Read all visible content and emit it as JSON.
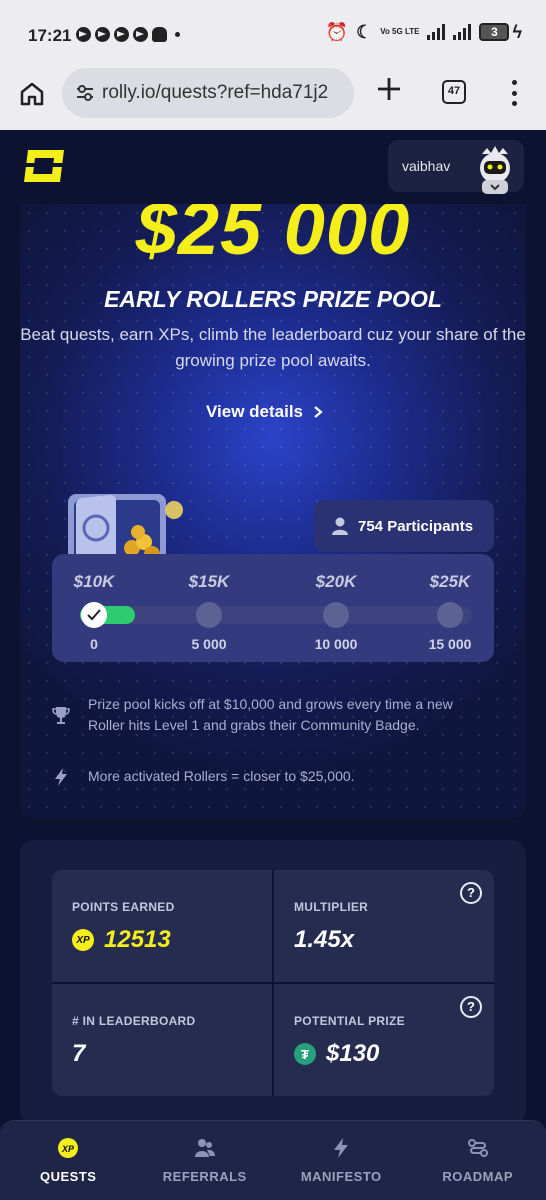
{
  "status_bar": {
    "time": "17:21",
    "network_label": "Vo 5G LTE",
    "battery": "3"
  },
  "browser": {
    "url": "rolly.io/quests?ref=hda71j2",
    "tab_count": "47"
  },
  "header": {
    "username": "vaibhav"
  },
  "hero": {
    "prize_amount": "$25 000",
    "title": "EARLY ROLLERS PRIZE POOL",
    "description": "Beat quests, earn XPs, climb the leaderboard cuz your share of the growing prize pool awaits.",
    "view_details": "View details",
    "participants": "754 Participants",
    "progress_fraction": 0.07,
    "tiers": [
      {
        "prize": "$10K",
        "xp": "0",
        "reached": true
      },
      {
        "prize": "$15K",
        "xp": "5 000",
        "reached": false
      },
      {
        "prize": "$20K",
        "xp": "10 000",
        "reached": false
      },
      {
        "prize": "$25K",
        "xp": "15 000",
        "reached": false
      }
    ],
    "note1": "Prize pool kicks off at $10,000 and grows every time a new Roller hits Level 1 and grabs their Community Badge.",
    "note2": "More activated Rollers = closer to $25,000."
  },
  "stats": {
    "points_label": "POINTS EARNED",
    "points_value": "12513",
    "multiplier_label": "MULTIPLIER",
    "multiplier_value": "1.45x",
    "leaderboard_label": "# IN LEADERBOARD",
    "leaderboard_value": "7",
    "prize_label": "POTENTIAL PRIZE",
    "prize_value": "$130",
    "xp_icon_text": "XP"
  },
  "nav": [
    {
      "label": "QUESTS",
      "icon": "xp-icon",
      "active": true
    },
    {
      "label": "REFERRALS",
      "icon": "users-icon",
      "active": false
    },
    {
      "label": "MANIFESTO",
      "icon": "lightning-icon",
      "active": false
    },
    {
      "label": "ROADMAP",
      "icon": "route-icon",
      "active": false
    }
  ],
  "colors": {
    "accent_yellow": "#f4ee1a",
    "progress_green": "#2ecc71",
    "background": "#0c1230"
  }
}
